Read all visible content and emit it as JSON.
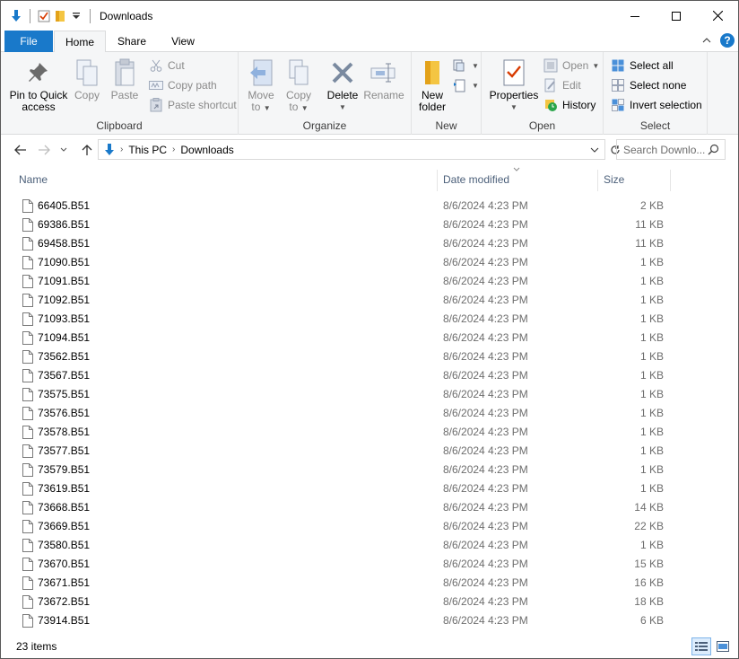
{
  "window": {
    "title": "Downloads"
  },
  "tabs": {
    "file": "File",
    "home": "Home",
    "share": "Share",
    "view": "View"
  },
  "ribbon": {
    "clipboard": {
      "label": "Clipboard",
      "pin_line1": "Pin to Quick",
      "pin_line2": "access",
      "copy": "Copy",
      "paste": "Paste",
      "cut": "Cut",
      "copy_path": "Copy path",
      "paste_shortcut": "Paste shortcut"
    },
    "organize": {
      "label": "Organize",
      "move": "Move",
      "move_to": "to",
      "copy": "Copy",
      "copy_to": "to",
      "delete": "Delete",
      "rename": "Rename"
    },
    "new": {
      "label": "New",
      "new_line1": "New",
      "new_line2": "folder"
    },
    "open": {
      "label": "Open",
      "properties": "Properties",
      "open": "Open",
      "edit": "Edit",
      "history": "History"
    },
    "select": {
      "label": "Select",
      "select_all": "Select all",
      "select_none": "Select none",
      "invert": "Invert selection"
    }
  },
  "address": {
    "crumbs": [
      "This PC",
      "Downloads"
    ],
    "search_placeholder": "Search Downlo..."
  },
  "columns": {
    "name": "Name",
    "date": "Date modified",
    "size": "Size"
  },
  "files": [
    {
      "name": "66405.B51",
      "date": "8/6/2024 4:23 PM",
      "size": "2 KB"
    },
    {
      "name": "69386.B51",
      "date": "8/6/2024 4:23 PM",
      "size": "11 KB"
    },
    {
      "name": "69458.B51",
      "date": "8/6/2024 4:23 PM",
      "size": "11 KB"
    },
    {
      "name": "71090.B51",
      "date": "8/6/2024 4:23 PM",
      "size": "1 KB"
    },
    {
      "name": "71091.B51",
      "date": "8/6/2024 4:23 PM",
      "size": "1 KB"
    },
    {
      "name": "71092.B51",
      "date": "8/6/2024 4:23 PM",
      "size": "1 KB"
    },
    {
      "name": "71093.B51",
      "date": "8/6/2024 4:23 PM",
      "size": "1 KB"
    },
    {
      "name": "71094.B51",
      "date": "8/6/2024 4:23 PM",
      "size": "1 KB"
    },
    {
      "name": "73562.B51",
      "date": "8/6/2024 4:23 PM",
      "size": "1 KB"
    },
    {
      "name": "73567.B51",
      "date": "8/6/2024 4:23 PM",
      "size": "1 KB"
    },
    {
      "name": "73575.B51",
      "date": "8/6/2024 4:23 PM",
      "size": "1 KB"
    },
    {
      "name": "73576.B51",
      "date": "8/6/2024 4:23 PM",
      "size": "1 KB"
    },
    {
      "name": "73578.B51",
      "date": "8/6/2024 4:23 PM",
      "size": "1 KB"
    },
    {
      "name": "73577.B51",
      "date": "8/6/2024 4:23 PM",
      "size": "1 KB"
    },
    {
      "name": "73579.B51",
      "date": "8/6/2024 4:23 PM",
      "size": "1 KB"
    },
    {
      "name": "73619.B51",
      "date": "8/6/2024 4:23 PM",
      "size": "1 KB"
    },
    {
      "name": "73668.B51",
      "date": "8/6/2024 4:23 PM",
      "size": "14 KB"
    },
    {
      "name": "73669.B51",
      "date": "8/6/2024 4:23 PM",
      "size": "22 KB"
    },
    {
      "name": "73580.B51",
      "date": "8/6/2024 4:23 PM",
      "size": "1 KB"
    },
    {
      "name": "73670.B51",
      "date": "8/6/2024 4:23 PM",
      "size": "15 KB"
    },
    {
      "name": "73671.B51",
      "date": "8/6/2024 4:23 PM",
      "size": "16 KB"
    },
    {
      "name": "73672.B51",
      "date": "8/6/2024 4:23 PM",
      "size": "18 KB"
    },
    {
      "name": "73914.B51",
      "date": "8/6/2024 4:23 PM",
      "size": "6 KB"
    }
  ],
  "status": {
    "item_count": "23 items"
  },
  "colors": {
    "accent": "#1979ca",
    "header_text": "#4c607a",
    "ribbon_bg": "#f5f6f7"
  }
}
